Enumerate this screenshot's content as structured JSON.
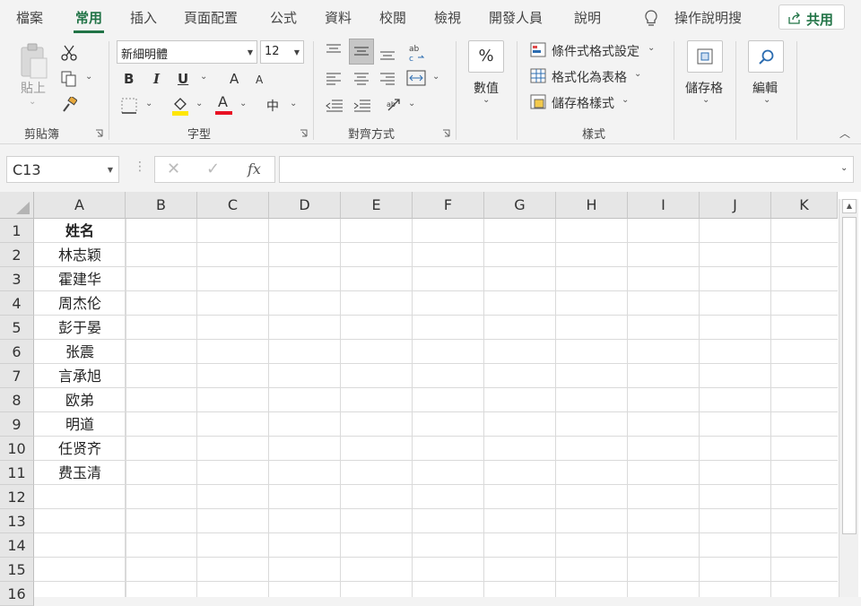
{
  "tabs": [
    "檔案",
    "常用",
    "插入",
    "頁面配置",
    "公式",
    "資料",
    "校閱",
    "檢視",
    "開發人員",
    "說明"
  ],
  "active_tab": "常用",
  "tell_me": "操作說明搜",
  "share_label": "共用",
  "ribbon": {
    "clipboard": {
      "paste": "貼上",
      "label": "剪貼簿"
    },
    "font": {
      "name": "新細明體",
      "size": "12",
      "label": "字型",
      "bold": "B",
      "italic": "I",
      "underline": "U",
      "grow": "A",
      "shrink": "A",
      "font_color_glyph": "A",
      "phonetic": "中"
    },
    "alignment": {
      "label": "對齊方式"
    },
    "number": {
      "symbol": "%",
      "label": "數值"
    },
    "styles": {
      "conditional": "條件式格式設定",
      "table": "格式化為表格",
      "cell_styles": "儲存格樣式",
      "label": "樣式"
    },
    "cells": {
      "label": "儲存格"
    },
    "editing": {
      "label": "編輯"
    }
  },
  "formula_bar": {
    "name_box": "C13",
    "fx": "fx",
    "formula": ""
  },
  "colors": {
    "accent": "#217346",
    "fill_yellow": "#ffe600",
    "font_red": "#e81123"
  },
  "sheet": {
    "columns": [
      "A",
      "B",
      "C",
      "D",
      "E",
      "F",
      "G",
      "H",
      "I",
      "J",
      "K"
    ],
    "rows": [
      "1",
      "2",
      "3",
      "4",
      "5",
      "6",
      "7",
      "8",
      "9",
      "10",
      "11",
      "12",
      "13",
      "14",
      "15",
      "16"
    ],
    "column_a": [
      "姓名",
      "林志颖",
      "霍建华",
      "周杰伦",
      "彭于晏",
      "张震",
      "言承旭",
      "欧弟",
      "明道",
      "任贤齐",
      "费玉清"
    ]
  }
}
